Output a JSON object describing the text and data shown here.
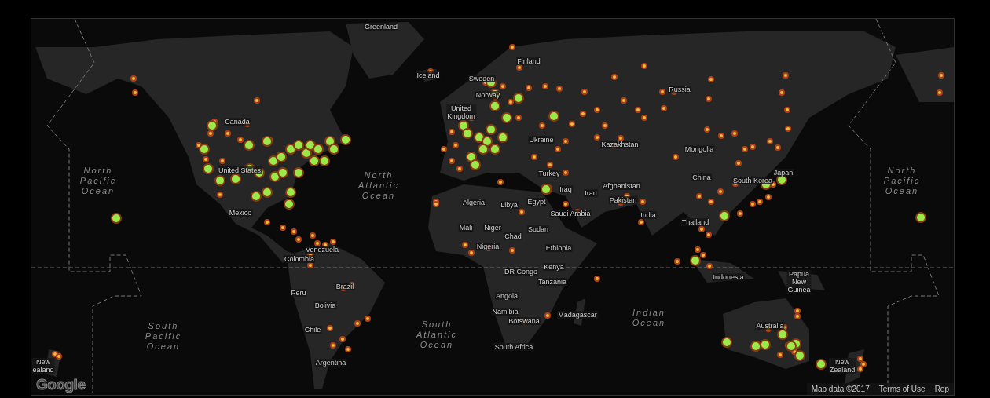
{
  "map": {
    "labels": [
      {
        "text": "Greenland",
        "kind": "country"
      },
      {
        "text": "Finland",
        "kind": "country"
      },
      {
        "text": "Iceland",
        "kind": "country"
      },
      {
        "text": "Sweden",
        "kind": "country"
      },
      {
        "text": "Russia",
        "kind": "country"
      },
      {
        "text": "Norway",
        "kind": "country"
      },
      {
        "text": "United Kingdom",
        "kind": "country"
      },
      {
        "text": "Canada",
        "kind": "country"
      },
      {
        "text": "Ukraine",
        "kind": "country"
      },
      {
        "text": "Kazakhstan",
        "kind": "country"
      },
      {
        "text": "Mongolia",
        "kind": "country"
      },
      {
        "text": "North Pacific Ocean",
        "kind": "ocean"
      },
      {
        "text": "United States",
        "kind": "country"
      },
      {
        "text": "Turkey",
        "kind": "country"
      },
      {
        "text": "China",
        "kind": "country"
      },
      {
        "text": "Japan",
        "kind": "country"
      },
      {
        "text": "South Korea",
        "kind": "country"
      },
      {
        "text": "North Pacific Ocean",
        "kind": "ocean"
      },
      {
        "text": "North Atlantic Ocean",
        "kind": "ocean"
      },
      {
        "text": "Afghanistan",
        "kind": "country"
      },
      {
        "text": "Iraq",
        "kind": "country"
      },
      {
        "text": "Iran",
        "kind": "country"
      },
      {
        "text": "Pakistan",
        "kind": "country"
      },
      {
        "text": "Algeria",
        "kind": "country"
      },
      {
        "text": "Libya",
        "kind": "country"
      },
      {
        "text": "Egypt",
        "kind": "country"
      },
      {
        "text": "Mexico",
        "kind": "country"
      },
      {
        "text": "Saudi Arabia",
        "kind": "country"
      },
      {
        "text": "India",
        "kind": "country"
      },
      {
        "text": "Thailand",
        "kind": "country"
      },
      {
        "text": "Mali",
        "kind": "country"
      },
      {
        "text": "Niger",
        "kind": "country"
      },
      {
        "text": "Sudan",
        "kind": "country"
      },
      {
        "text": "Chad",
        "kind": "country"
      },
      {
        "text": "Venezuela",
        "kind": "country"
      },
      {
        "text": "Nigeria",
        "kind": "country"
      },
      {
        "text": "Ethiopia",
        "kind": "country"
      },
      {
        "text": "Colombia",
        "kind": "country"
      },
      {
        "text": "Kenya",
        "kind": "country"
      },
      {
        "text": "DR Congo",
        "kind": "country"
      },
      {
        "text": "Indonesia",
        "kind": "country"
      },
      {
        "text": "Brazil",
        "kind": "country"
      },
      {
        "text": "Tanzania",
        "kind": "country"
      },
      {
        "text": "Papua New Guinea",
        "kind": "country"
      },
      {
        "text": "Peru",
        "kind": "country"
      },
      {
        "text": "Angola",
        "kind": "country"
      },
      {
        "text": "Bolivia",
        "kind": "country"
      },
      {
        "text": "Namibia",
        "kind": "country"
      },
      {
        "text": "South Pacific Ocean",
        "kind": "ocean"
      },
      {
        "text": "Chile",
        "kind": "country"
      },
      {
        "text": "South Atlantic Ocean",
        "kind": "ocean"
      },
      {
        "text": "Botswana",
        "kind": "country"
      },
      {
        "text": "Madagascar",
        "kind": "country"
      },
      {
        "text": "Indian Ocean",
        "kind": "ocean"
      },
      {
        "text": "Australia",
        "kind": "country"
      },
      {
        "text": "South Africa",
        "kind": "country"
      },
      {
        "text": "New ealand",
        "kind": "country"
      },
      {
        "text": "Argentina",
        "kind": "country"
      },
      {
        "text": "New Zealand",
        "kind": "country"
      }
    ],
    "logo": "Google",
    "attribution": [
      {
        "text": "Map data ©2017"
      },
      {
        "text": "Terms of Use"
      },
      {
        "text": "Rep"
      }
    ]
  }
}
